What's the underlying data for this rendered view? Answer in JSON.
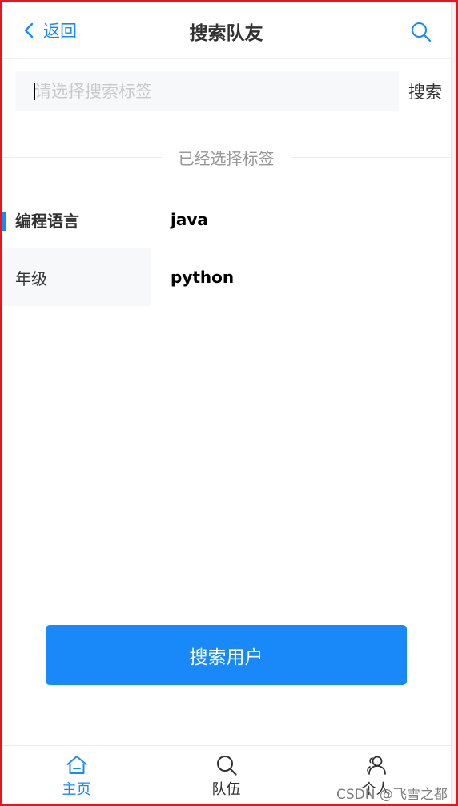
{
  "navbar": {
    "back_label": "返回",
    "title": "搜索队友",
    "search_icon": "search-icon",
    "accent": "#1989fa"
  },
  "search": {
    "placeholder": "请选择搜索标签",
    "value": "",
    "action_label": "搜索"
  },
  "divider": {
    "text": "已经选择标签"
  },
  "tree": {
    "nav_items": [
      {
        "label": "编程语言",
        "active": true
      },
      {
        "label": "年级",
        "active": false
      }
    ],
    "content_items": [
      {
        "label": "java"
      },
      {
        "label": "python"
      }
    ]
  },
  "primary_button": {
    "label": "搜索用户",
    "color": "#1989fa"
  },
  "tabbar": {
    "tabs": [
      {
        "label": "主页",
        "icon": "home-icon",
        "active": true
      },
      {
        "label": "队伍",
        "icon": "search-icon",
        "active": false
      },
      {
        "label": "个人",
        "icon": "user-icon",
        "active": false
      }
    ]
  },
  "watermark": "CSDN @飞雪之都"
}
